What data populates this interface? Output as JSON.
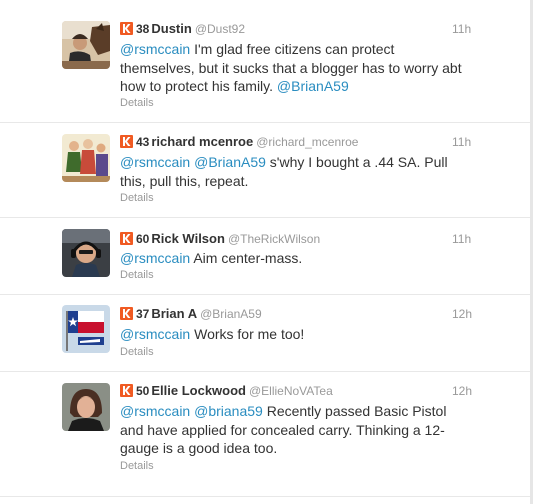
{
  "tweets": [
    {
      "score": "38",
      "fullname": "Dustin",
      "handle": "@Dust92",
      "time": "11h",
      "lines": [
        [
          {
            "t": "@rsmccain",
            "m": true
          },
          {
            "t": " I'm glad free citizens can protect",
            "m": false
          }
        ],
        [
          {
            "t": "themselves, but it sucks that a blogger has to worry abt",
            "m": false
          }
        ],
        [
          {
            "t": "how to protect his family. ",
            "m": false
          },
          {
            "t": "@BrianA59",
            "m": true
          }
        ]
      ],
      "details": "Details",
      "avatar_icon": "man-with-horse-avatar"
    },
    {
      "score": "43",
      "fullname": "richard mcenroe",
      "handle": "@richard_mcenroe",
      "time": "11h",
      "lines": [
        [
          {
            "t": "@rsmccain",
            "m": true
          },
          {
            "t": " ",
            "m": false
          },
          {
            "t": "@BrianA59",
            "m": true
          },
          {
            "t": " s'why I bought a .44 SA. Pull",
            "m": false
          }
        ],
        [
          {
            "t": "this, pull this, repeat.",
            "m": false
          }
        ]
      ],
      "details": "Details",
      "avatar_icon": "cartoon-figures-avatar"
    },
    {
      "score": "60",
      "fullname": "Rick Wilson",
      "handle": "@TheRickWilson",
      "time": "11h",
      "lines": [
        [
          {
            "t": "@rsmccain",
            "m": true
          },
          {
            "t": " Aim center-mass.",
            "m": false
          }
        ]
      ],
      "details": "Details",
      "avatar_icon": "pilot-with-headset-avatar"
    },
    {
      "score": "37",
      "fullname": "Brian A",
      "handle": "@BrianA59",
      "time": "12h",
      "lines": [
        [
          {
            "t": "@rsmccain",
            "m": true
          },
          {
            "t": " Works for me too!",
            "m": false
          }
        ]
      ],
      "details": "Details",
      "avatar_icon": "texas-flag-avatar"
    },
    {
      "score": "50",
      "fullname": "Ellie Lockwood",
      "handle": "@EllieNoVATea",
      "time": "12h",
      "lines": [
        [
          {
            "t": "@rsmccain",
            "m": true
          },
          {
            "t": " ",
            "m": false
          },
          {
            "t": "@briana59",
            "m": true
          },
          {
            "t": " Recently passed Basic Pistol",
            "m": false
          }
        ],
        [
          {
            "t": "and have applied for concealed carry. Thinking a 12-",
            "m": false
          }
        ],
        [
          {
            "t": "gauge is a good idea too.",
            "m": false
          }
        ]
      ],
      "details": "Details",
      "avatar_icon": "woman-portrait-avatar"
    }
  ],
  "colors": {
    "accent_link": "#2a8dc0",
    "klout_orange": "#f05a22",
    "muted_text": "#999999",
    "body_text": "#333333",
    "divider": "#e8e8e8"
  }
}
